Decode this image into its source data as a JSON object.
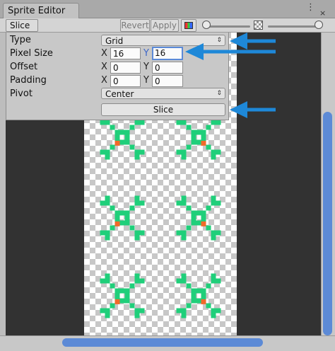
{
  "window": {
    "title": "Sprite Editor",
    "menu_icon": "⋮",
    "close_icon": "×"
  },
  "toolbar": {
    "mode_label": "Slice",
    "mode_arrow": "⇕",
    "revert_label": "Revert",
    "apply_label": "Apply"
  },
  "panel": {
    "type": {
      "label": "Type",
      "value": "Grid"
    },
    "pixel_size": {
      "label": "Pixel Size",
      "x_axis": "X",
      "x": "16",
      "y_axis": "Y",
      "y": "16"
    },
    "offset": {
      "label": "Offset",
      "x_axis": "X",
      "x": "0",
      "y_axis": "Y",
      "y": "0"
    },
    "padding": {
      "label": "Padding",
      "x_axis": "X",
      "x": "0",
      "y_axis": "Y",
      "y": "0"
    },
    "pivot": {
      "label": "Pivot",
      "value": "Center"
    },
    "slice_button": "Slice",
    "dropdown_arrow": "⇕"
  },
  "colors": {
    "sprite_green": "#1fcf7a",
    "sprite_orange": "#f06a2a",
    "annotation_arrow": "#1e88d8",
    "scroll_thumb": "#5c8ad6"
  }
}
